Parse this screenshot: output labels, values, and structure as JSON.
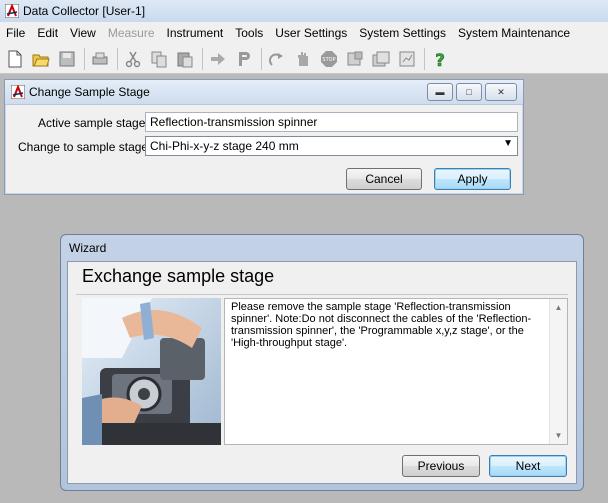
{
  "app": {
    "title": "Data Collector [User-1]"
  },
  "menu": [
    {
      "label": "File",
      "disabled": false
    },
    {
      "label": "Edit",
      "disabled": false
    },
    {
      "label": "View",
      "disabled": false
    },
    {
      "label": "Measure",
      "disabled": true
    },
    {
      "label": "Instrument",
      "disabled": false
    },
    {
      "label": "Tools",
      "disabled": false
    },
    {
      "label": "User Settings",
      "disabled": false
    },
    {
      "label": "System Settings",
      "disabled": false
    },
    {
      "label": "System Maintenance",
      "disabled": false
    }
  ],
  "toolbar": {
    "icons": [
      "new-document-icon",
      "open-folder-icon",
      "save-icon",
      "print-icon",
      "cut-icon",
      "copy-icon",
      "paste-icon",
      "forward-arrow-icon",
      "p-icon",
      "redo-icon",
      "hand-icon",
      "stop-icon",
      "settings-sheet-icon",
      "settings-sheets-icon",
      "report-icon",
      "help-icon"
    ]
  },
  "change_stage": {
    "title": "Change Sample Stage",
    "active_label": "Active sample stage:",
    "active_value": "Reflection-transmission spinner",
    "change_label": "Change to sample stage:",
    "change_value": "Chi-Phi-x-y-z stage 240 mm",
    "cancel": "Cancel",
    "apply": "Apply"
  },
  "wizard": {
    "title": "Wizard",
    "heading": "Exchange sample stage",
    "message": "Please remove the sample stage 'Reflection-transmission spinner'. Note:Do not disconnect the cables of the 'Reflection-transmission spinner', the 'Programmable x,y,z stage', or the 'High-throughput stage'.",
    "previous": "Previous",
    "next": "Next"
  }
}
